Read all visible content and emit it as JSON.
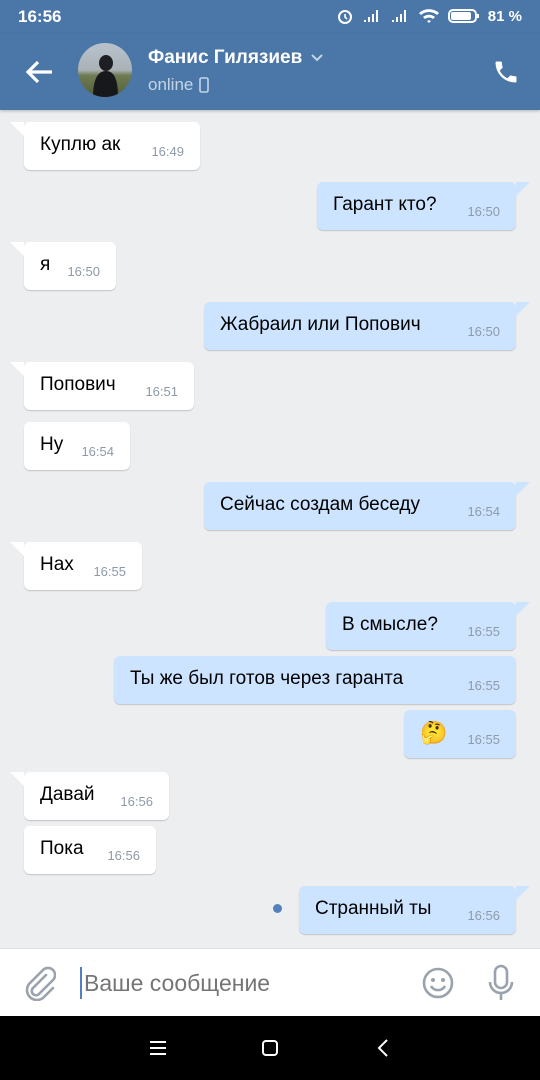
{
  "status_bar": {
    "time": "16:56",
    "battery": "81 %"
  },
  "header": {
    "name": "Фанис Гилязиев",
    "status": "online"
  },
  "messages": [
    {
      "text": "Куплю ак",
      "time": "16:49",
      "direction": "in"
    },
    {
      "text": "Гарант кто?",
      "time": "16:50",
      "direction": "out"
    },
    {
      "text": "я",
      "time": "16:50",
      "direction": "in"
    },
    {
      "text": "Жабраил или Попович",
      "time": "16:50",
      "direction": "out"
    },
    {
      "text": "Попович",
      "time": "16:51",
      "direction": "in"
    },
    {
      "text": "Ну",
      "time": "16:54",
      "direction": "in"
    },
    {
      "text": "Сейчас создам беседу",
      "time": "16:54",
      "direction": "out"
    },
    {
      "text": "Нах",
      "time": "16:55",
      "direction": "in"
    },
    {
      "text": "В смысле?",
      "time": "16:55",
      "direction": "out"
    },
    {
      "text": "Ты же был готов через гаранта",
      "time": "16:55",
      "direction": "out"
    },
    {
      "text": "🤔",
      "time": "16:55",
      "direction": "out"
    },
    {
      "text": "Давай",
      "time": "16:56",
      "direction": "in"
    },
    {
      "text": "Пока",
      "time": "16:56",
      "direction": "in"
    },
    {
      "text": "Странный ты",
      "time": "16:56",
      "direction": "out"
    }
  ],
  "composer": {
    "placeholder": "Ваше сообщение"
  },
  "icons": {
    "back": "arrow-left-icon",
    "phone": "phone-icon",
    "attach": "paperclip-icon",
    "emoji": "smile-icon",
    "voice": "microphone-icon",
    "mobile": "mobile-device-icon",
    "nav_menu": "menu-icon",
    "nav_home": "home-square-icon",
    "nav_back": "nav-back-icon"
  },
  "colors": {
    "header": "#4a76a8",
    "outgoing_bubble": "#cce4ff",
    "incoming_bubble": "#ffffff",
    "background": "#edeef0"
  }
}
